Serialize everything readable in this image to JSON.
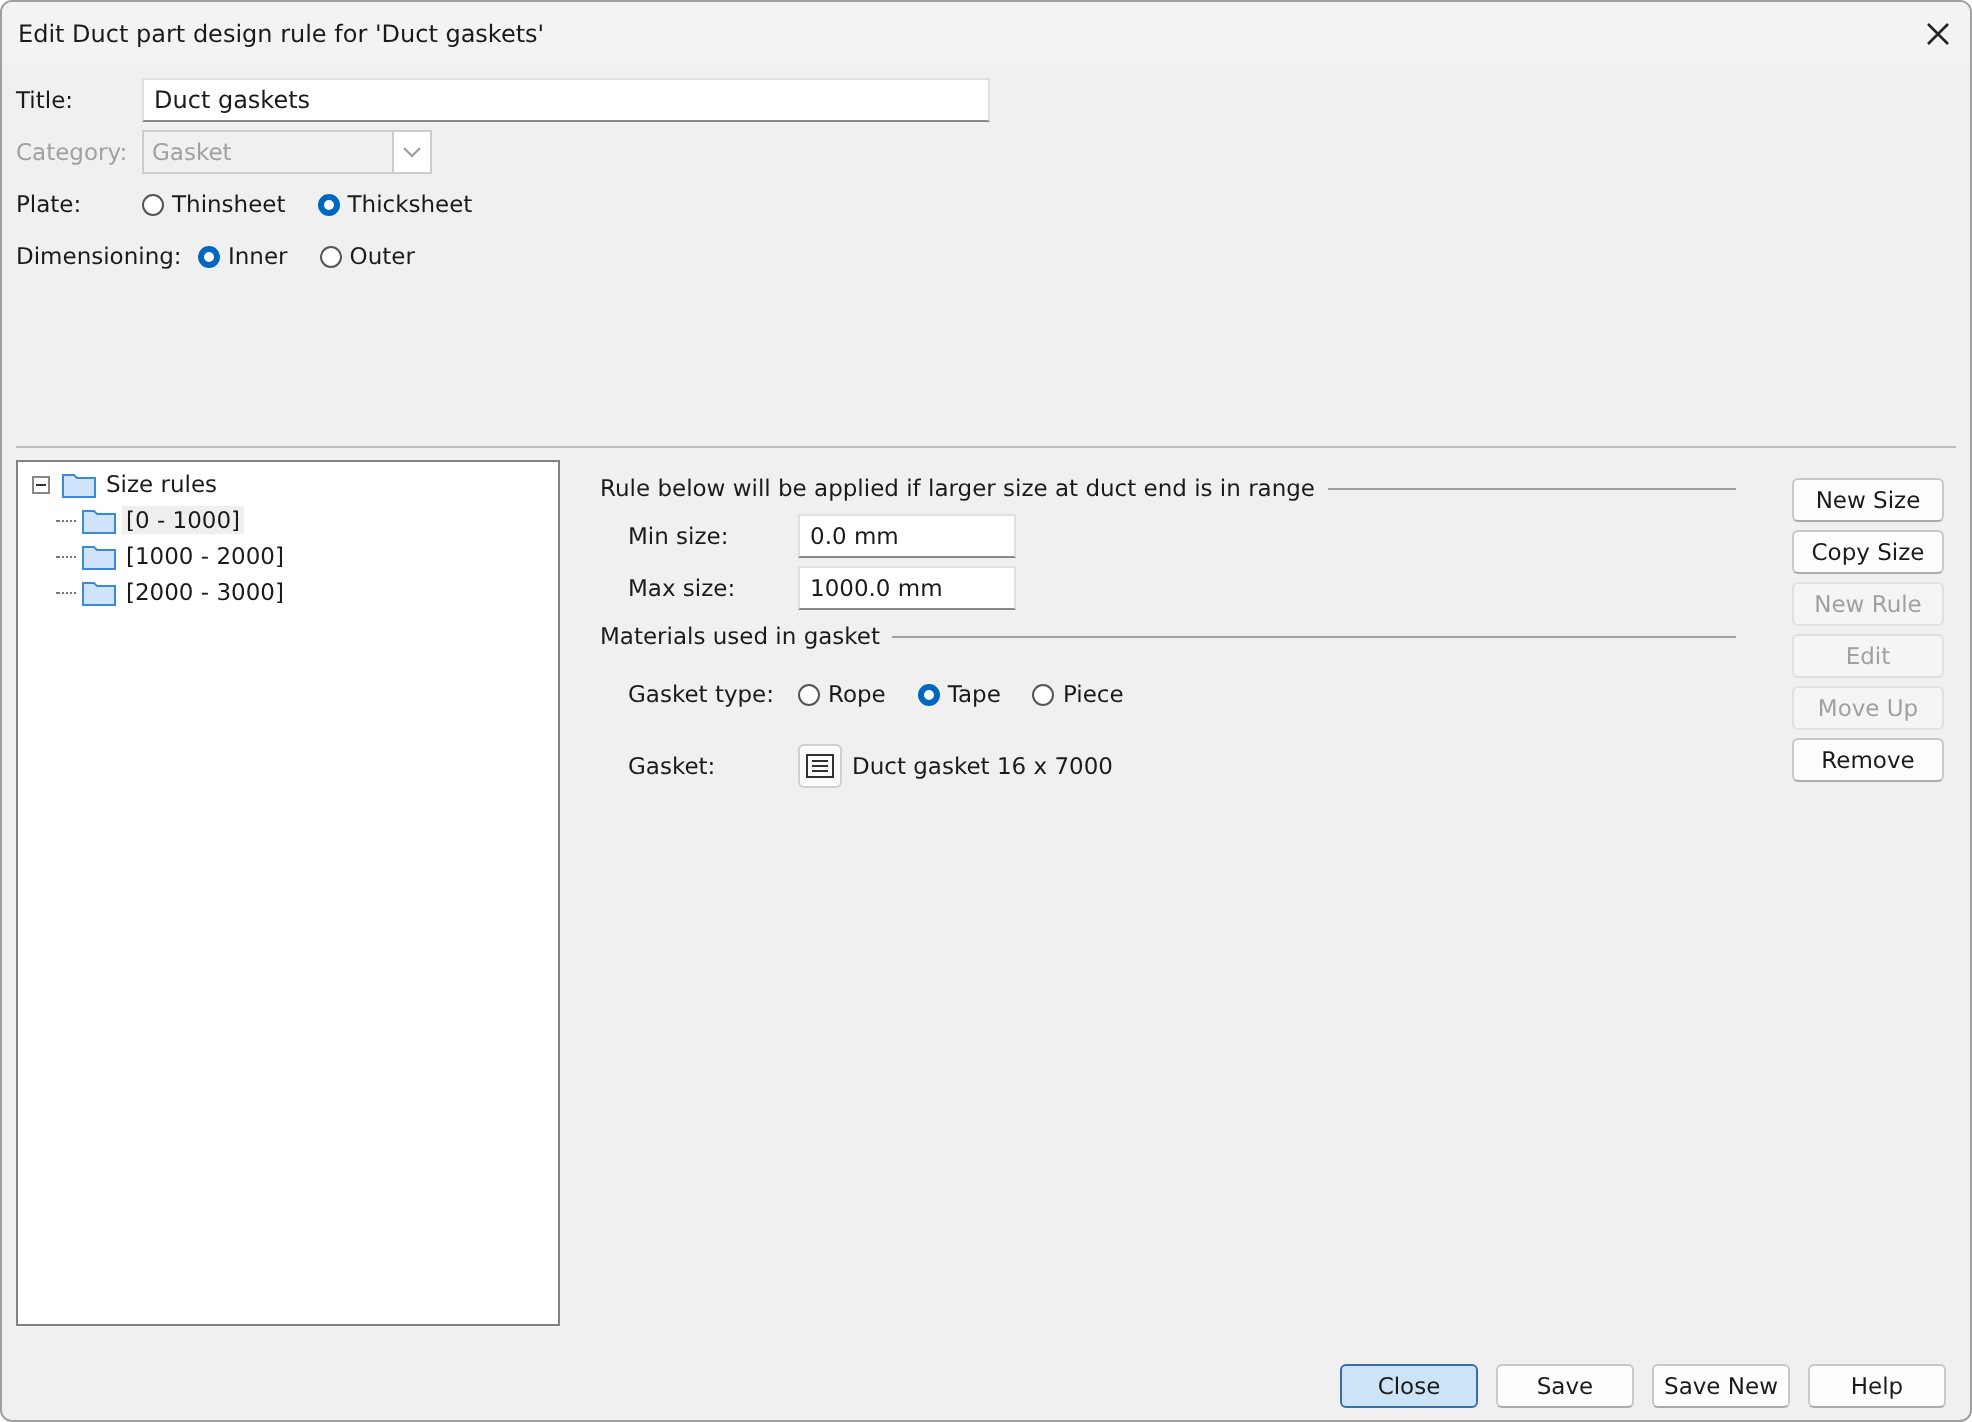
{
  "window": {
    "title": "Edit Duct part design rule for 'Duct gaskets'"
  },
  "form": {
    "title": {
      "label": "Title:",
      "value": "Duct gaskets"
    },
    "category": {
      "label": "Category:",
      "value": "Gasket",
      "disabled": true
    },
    "plate": {
      "label": "Plate:",
      "options": [
        {
          "label": "Thinsheet",
          "selected": false
        },
        {
          "label": "Thicksheet",
          "selected": true
        }
      ]
    },
    "dimensioning": {
      "label": "Dimensioning:",
      "options": [
        {
          "label": "Inner",
          "selected": true
        },
        {
          "label": "Outer",
          "selected": false
        }
      ]
    }
  },
  "tree": {
    "label": "Size rules",
    "expanded": true,
    "children": [
      {
        "label": "[0 - 1000]",
        "selected": true
      },
      {
        "label": "[1000 - 2000]",
        "selected": false
      },
      {
        "label": "[2000 - 3000]",
        "selected": false
      }
    ]
  },
  "rule": {
    "heading": "Rule below will be applied if larger size at duct end is in range",
    "min": {
      "label": "Min size:",
      "value": "0.0 mm"
    },
    "max": {
      "label": "Max size:",
      "value": "1000.0 mm"
    },
    "materials_heading": "Materials used in gasket",
    "gasket_type": {
      "label": "Gasket type:",
      "options": [
        {
          "label": "Rope",
          "selected": false
        },
        {
          "label": "Tape",
          "selected": true
        },
        {
          "label": "Piece",
          "selected": false
        }
      ]
    },
    "gasket": {
      "label": "Gasket:",
      "value": "Duct gasket 16 x 7000"
    }
  },
  "side_buttons": [
    {
      "label": "New Size",
      "disabled": false
    },
    {
      "label": "Copy Size",
      "disabled": false
    },
    {
      "label": "New Rule",
      "disabled": true
    },
    {
      "label": "Edit",
      "disabled": true
    },
    {
      "label": "Move Up",
      "disabled": true
    },
    {
      "label": "Remove",
      "disabled": false
    }
  ],
  "footer_buttons": [
    {
      "label": "Close",
      "default": true
    },
    {
      "label": "Save",
      "default": false
    },
    {
      "label": "Save New",
      "default": false
    },
    {
      "label": "Help",
      "default": false
    }
  ]
}
